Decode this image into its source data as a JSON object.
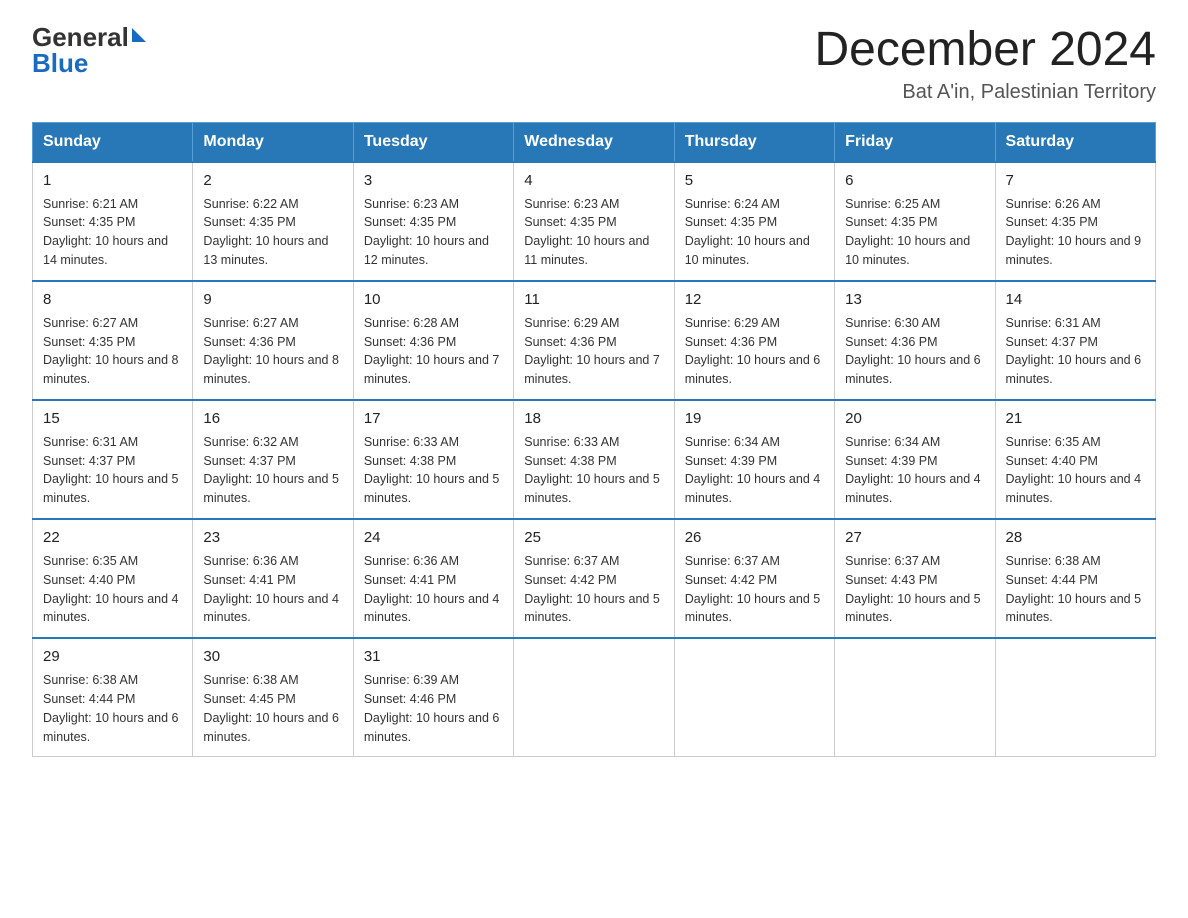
{
  "logo": {
    "general": "General",
    "blue": "Blue"
  },
  "header": {
    "month": "December 2024",
    "location": "Bat A'in, Palestinian Territory"
  },
  "days_of_week": [
    "Sunday",
    "Monday",
    "Tuesday",
    "Wednesday",
    "Thursday",
    "Friday",
    "Saturday"
  ],
  "weeks": [
    [
      {
        "day": "1",
        "sunrise": "6:21 AM",
        "sunset": "4:35 PM",
        "daylight": "10 hours and 14 minutes."
      },
      {
        "day": "2",
        "sunrise": "6:22 AM",
        "sunset": "4:35 PM",
        "daylight": "10 hours and 13 minutes."
      },
      {
        "day": "3",
        "sunrise": "6:23 AM",
        "sunset": "4:35 PM",
        "daylight": "10 hours and 12 minutes."
      },
      {
        "day": "4",
        "sunrise": "6:23 AM",
        "sunset": "4:35 PM",
        "daylight": "10 hours and 11 minutes."
      },
      {
        "day": "5",
        "sunrise": "6:24 AM",
        "sunset": "4:35 PM",
        "daylight": "10 hours and 10 minutes."
      },
      {
        "day": "6",
        "sunrise": "6:25 AM",
        "sunset": "4:35 PM",
        "daylight": "10 hours and 10 minutes."
      },
      {
        "day": "7",
        "sunrise": "6:26 AM",
        "sunset": "4:35 PM",
        "daylight": "10 hours and 9 minutes."
      }
    ],
    [
      {
        "day": "8",
        "sunrise": "6:27 AM",
        "sunset": "4:35 PM",
        "daylight": "10 hours and 8 minutes."
      },
      {
        "day": "9",
        "sunrise": "6:27 AM",
        "sunset": "4:36 PM",
        "daylight": "10 hours and 8 minutes."
      },
      {
        "day": "10",
        "sunrise": "6:28 AM",
        "sunset": "4:36 PM",
        "daylight": "10 hours and 7 minutes."
      },
      {
        "day": "11",
        "sunrise": "6:29 AM",
        "sunset": "4:36 PM",
        "daylight": "10 hours and 7 minutes."
      },
      {
        "day": "12",
        "sunrise": "6:29 AM",
        "sunset": "4:36 PM",
        "daylight": "10 hours and 6 minutes."
      },
      {
        "day": "13",
        "sunrise": "6:30 AM",
        "sunset": "4:36 PM",
        "daylight": "10 hours and 6 minutes."
      },
      {
        "day": "14",
        "sunrise": "6:31 AM",
        "sunset": "4:37 PM",
        "daylight": "10 hours and 6 minutes."
      }
    ],
    [
      {
        "day": "15",
        "sunrise": "6:31 AM",
        "sunset": "4:37 PM",
        "daylight": "10 hours and 5 minutes."
      },
      {
        "day": "16",
        "sunrise": "6:32 AM",
        "sunset": "4:37 PM",
        "daylight": "10 hours and 5 minutes."
      },
      {
        "day": "17",
        "sunrise": "6:33 AM",
        "sunset": "4:38 PM",
        "daylight": "10 hours and 5 minutes."
      },
      {
        "day": "18",
        "sunrise": "6:33 AM",
        "sunset": "4:38 PM",
        "daylight": "10 hours and 5 minutes."
      },
      {
        "day": "19",
        "sunrise": "6:34 AM",
        "sunset": "4:39 PM",
        "daylight": "10 hours and 4 minutes."
      },
      {
        "day": "20",
        "sunrise": "6:34 AM",
        "sunset": "4:39 PM",
        "daylight": "10 hours and 4 minutes."
      },
      {
        "day": "21",
        "sunrise": "6:35 AM",
        "sunset": "4:40 PM",
        "daylight": "10 hours and 4 minutes."
      }
    ],
    [
      {
        "day": "22",
        "sunrise": "6:35 AM",
        "sunset": "4:40 PM",
        "daylight": "10 hours and 4 minutes."
      },
      {
        "day": "23",
        "sunrise": "6:36 AM",
        "sunset": "4:41 PM",
        "daylight": "10 hours and 4 minutes."
      },
      {
        "day": "24",
        "sunrise": "6:36 AM",
        "sunset": "4:41 PM",
        "daylight": "10 hours and 4 minutes."
      },
      {
        "day": "25",
        "sunrise": "6:37 AM",
        "sunset": "4:42 PM",
        "daylight": "10 hours and 5 minutes."
      },
      {
        "day": "26",
        "sunrise": "6:37 AM",
        "sunset": "4:42 PM",
        "daylight": "10 hours and 5 minutes."
      },
      {
        "day": "27",
        "sunrise": "6:37 AM",
        "sunset": "4:43 PM",
        "daylight": "10 hours and 5 minutes."
      },
      {
        "day": "28",
        "sunrise": "6:38 AM",
        "sunset": "4:44 PM",
        "daylight": "10 hours and 5 minutes."
      }
    ],
    [
      {
        "day": "29",
        "sunrise": "6:38 AM",
        "sunset": "4:44 PM",
        "daylight": "10 hours and 6 minutes."
      },
      {
        "day": "30",
        "sunrise": "6:38 AM",
        "sunset": "4:45 PM",
        "daylight": "10 hours and 6 minutes."
      },
      {
        "day": "31",
        "sunrise": "6:39 AM",
        "sunset": "4:46 PM",
        "daylight": "10 hours and 6 minutes."
      },
      null,
      null,
      null,
      null
    ]
  ]
}
